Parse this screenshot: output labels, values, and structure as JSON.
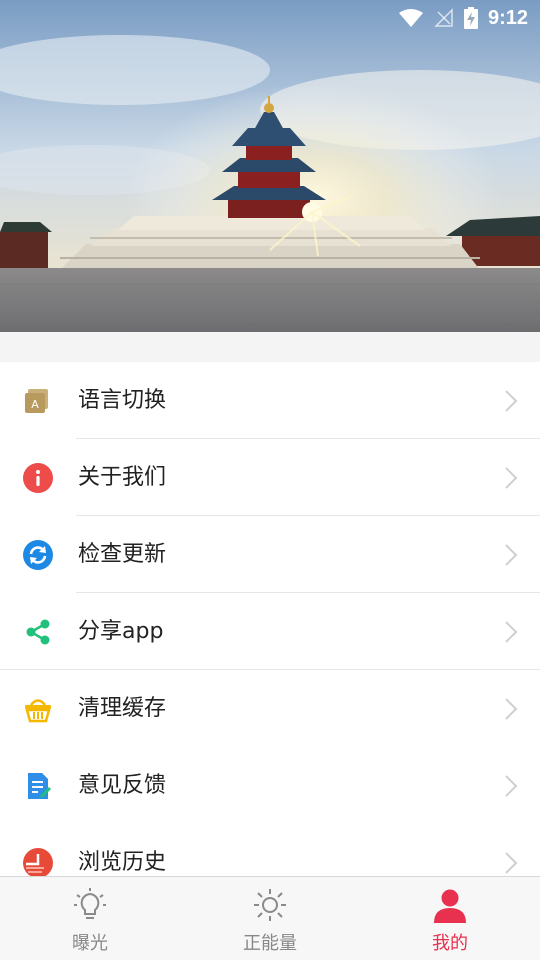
{
  "status_bar": {
    "time": "9:12"
  },
  "menu": {
    "items": [
      {
        "label": "语言切换",
        "icon": "language-icon"
      },
      {
        "label": "关于我们",
        "icon": "info-icon"
      },
      {
        "label": "检查更新",
        "icon": "refresh-icon"
      },
      {
        "label": "分享app",
        "icon": "share-icon"
      },
      {
        "label": "清理缓存",
        "icon": "basket-icon"
      },
      {
        "label": "意见反馈",
        "icon": "feedback-icon"
      },
      {
        "label": "浏览历史",
        "icon": "history-icon"
      }
    ]
  },
  "tabbar": {
    "tabs": [
      {
        "label": "曝光",
        "icon": "lightbulb-icon",
        "active": false
      },
      {
        "label": "正能量",
        "icon": "sun-icon",
        "active": false
      },
      {
        "label": "我的",
        "icon": "person-icon",
        "active": true
      }
    ]
  },
  "colors": {
    "accent": "#e8304f",
    "info": "#ee4b4b",
    "refresh": "#1e88e5",
    "share": "#22c07a",
    "basket": "#f5b800",
    "feedback": "#2f8ee8",
    "history": "#e84a3a"
  }
}
